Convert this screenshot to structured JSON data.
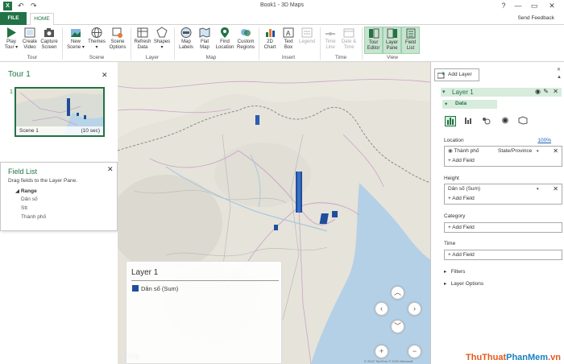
{
  "titlebar": {
    "title": "Book1 - 3D Maps",
    "help": "?",
    "minimize": "—",
    "restore": "▭",
    "close": "✕"
  },
  "tabs": {
    "file": "FILE",
    "home": "HOME",
    "send_feedback": "Send Feedback"
  },
  "ribbon": {
    "buttons": [
      {
        "label": "Play",
        "label2": "Tour ▾"
      },
      {
        "label": "Create",
        "label2": "Video"
      },
      {
        "label": "Capture",
        "label2": "Screen"
      },
      {
        "label": "New",
        "label2": "Scene ▾"
      },
      {
        "label": "Themes",
        "label2": "▾"
      },
      {
        "label": "Scene",
        "label2": "Options"
      },
      {
        "label": "Refresh",
        "label2": "Data"
      },
      {
        "label": "Shapes",
        "label2": "▾"
      },
      {
        "label": "Map",
        "label2": "Labels"
      },
      {
        "label": "Flat",
        "label2": "Map"
      },
      {
        "label": "Find",
        "label2": "Location"
      },
      {
        "label": "Custom",
        "label2": "Regions"
      },
      {
        "label": "2D",
        "label2": "Chart"
      },
      {
        "label": "Text",
        "label2": "Box"
      },
      {
        "label": "Legend",
        "label2": ""
      },
      {
        "label": "Time",
        "label2": "Line"
      },
      {
        "label": "Date &",
        "label2": "Time"
      },
      {
        "label": "Tour",
        "label2": "Editor"
      },
      {
        "label": "Layer",
        "label2": "Pane"
      },
      {
        "label": "Field",
        "label2": "List"
      }
    ],
    "groups": [
      "Tour",
      "Scene",
      "Layer",
      "Map",
      "Insert",
      "Time",
      "View"
    ]
  },
  "tour": {
    "title": "Tour 1",
    "scene_number": "1",
    "scene_name": "Scene 1",
    "scene_duration": "(10 sec)"
  },
  "field_list": {
    "title": "Field List",
    "hint": "Drag fields to the Layer Pane.",
    "range": "Range",
    "fields": [
      "Dân số",
      "Stt",
      "Thành phố"
    ]
  },
  "legend": {
    "title": "Layer 1",
    "entry": "Dân số (Sum)",
    "color": "#1f4e9c"
  },
  "map": {
    "bing": "bing",
    "copyright": "© 2022 TomTom © 2022 Microsoft"
  },
  "layer_pane": {
    "add_layer": "Add Layer",
    "layer_name": "Layer 1",
    "data_label": "Data",
    "location_label": "Location",
    "location_pct": "100%",
    "location_field": "Thành phố",
    "location_type": "State/Province",
    "add_field": "Add Field",
    "height_label": "Height",
    "height_field": "Dân số (Sum)",
    "category_label": "Category",
    "time_label": "Time",
    "filters": "Filters",
    "layer_options": "Layer Options"
  },
  "watermark": {
    "part1": "ThuThuat",
    "part2": "PhanMem",
    "part3": ".vn"
  },
  "colors": {
    "accent": "#217346",
    "bar": "#1f4e9c"
  }
}
